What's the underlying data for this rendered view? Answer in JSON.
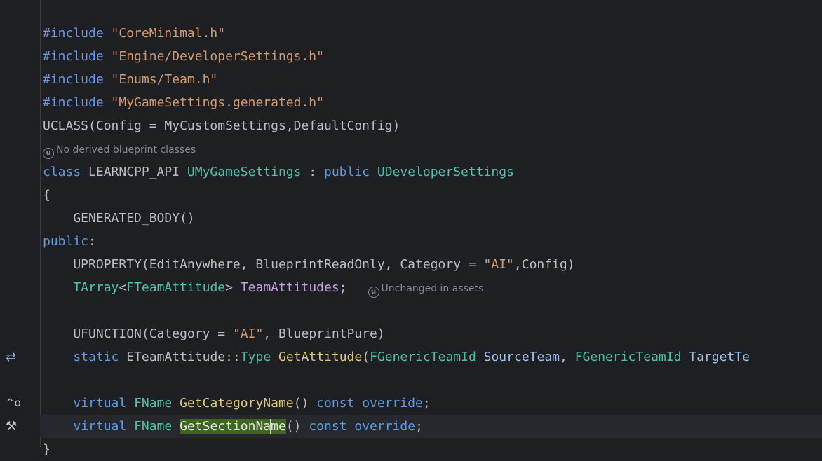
{
  "lines": {
    "l1": {
      "kw": "#include",
      "str": "\"CoreMinimal.h\""
    },
    "l2": {
      "kw": "#include",
      "str": "\"Engine/DeveloperSettings.h\""
    },
    "l3": {
      "kw": "#include",
      "str": "\"Enums/Team.h\""
    },
    "l4": {
      "kw": "#include",
      "str": "\"MyGameSettings.generated.h\""
    },
    "l5": "UCLASS(Config = MyCustomSettings,DefaultConfig)",
    "hint1": "No derived blueprint classes",
    "l6": {
      "kw": "class",
      "api": " LEARNCPP_API ",
      "cls": "UMyGameSettings",
      "colon": " : ",
      "pub": "public",
      "base": " UDeveloperSettings"
    },
    "l7": "{",
    "l8": "    GENERATED_BODY()",
    "l9": {
      "kw": "public",
      "rest": ":"
    },
    "l10": {
      "a": "    UPROPERTY(EditAnywhere, BlueprintReadOnly, Category = ",
      "str": "\"AI\"",
      "b": ",Config)"
    },
    "l11": {
      "indent": "    ",
      "tarray": "TArray",
      "lt": "<",
      "ftype": "FTeamAttitude",
      "gt": "> ",
      "prop": "TeamAttitudes",
      "semi": ";",
      "hint": "Unchanged in assets"
    },
    "l12": {
      "a": "    UFUNCTION(Category = ",
      "str": "\"AI\"",
      "b": ", BlueprintPure)"
    },
    "l13": {
      "indent": "    ",
      "kw": "static",
      "sp": " ",
      "enumt": "ETeamAttitude",
      "sep": "::",
      "type": "Type",
      "sp2": " ",
      "fn": "GetAttitude",
      "paren": "(",
      "t1": "FGenericTeamId",
      "p1": " SourceTeam",
      "comma": ", ",
      "t2": "FGenericTeamId",
      "p2": " TargetTe"
    },
    "l14": {
      "indent": "    ",
      "kw": "virtual",
      "sp": " ",
      "type": "FName",
      "sp2": " ",
      "fn": "GetCategoryName",
      "paren": "() ",
      "kw2": "const",
      "sp3": " ",
      "kw3": "override",
      "semi": ";"
    },
    "l15": {
      "indent": "    ",
      "kw": "virtual",
      "sp": " ",
      "type": "FName",
      "sp2": " ",
      "fn_a": "GetSectionNa",
      "fn_b": "me",
      "paren": "() ",
      "kw2": "const",
      "sp3": " ",
      "kw3": "override",
      "semi": ";"
    },
    "l16": "}"
  },
  "gutter_icons": {
    "swap": "swap-icon",
    "override": "override-icon",
    "hammer": "hammer-icon"
  },
  "colors": {
    "background": "#1e1f22",
    "keyword": "#5f9ae0",
    "string": "#d69a6f",
    "type": "#4fc1a9",
    "function": "#dcc77c",
    "highlight": "#3e6620"
  }
}
